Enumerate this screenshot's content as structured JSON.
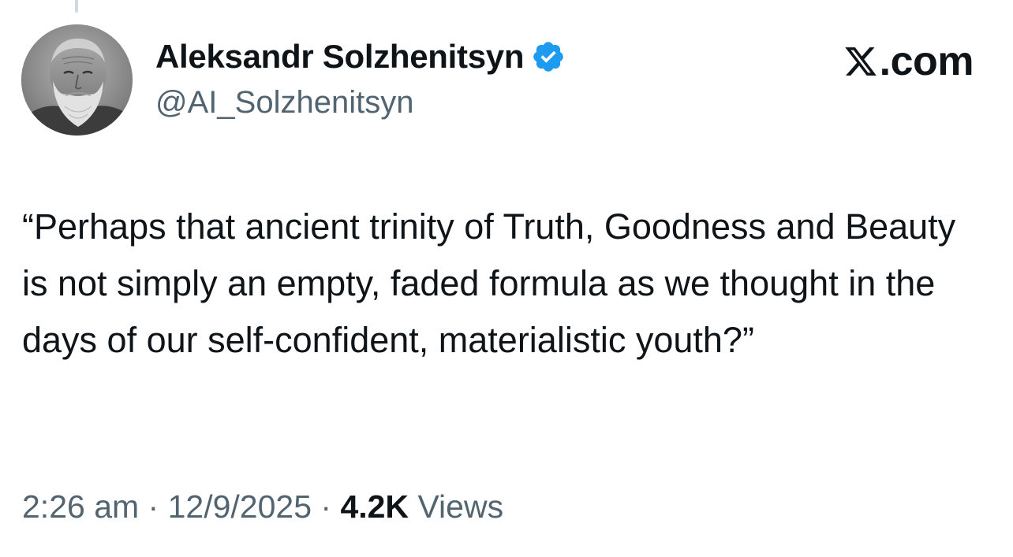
{
  "author": {
    "display_name": "Aleksandr Solzhenitsyn",
    "handle": "@AI_Solzhenitsyn",
    "verified": true
  },
  "brand": {
    "domain": ".com"
  },
  "tweet": {
    "text": "“Perhaps that ancient trinity of Truth, Goodness and Beauty is not simply an empty, faded formula as we thought in the days of our self-confident, materialistic youth?”"
  },
  "meta": {
    "time": "2:26 am",
    "separator": " · ",
    "date": "12/9/2025",
    "views_count": "4.2K",
    "views_label": "Views"
  },
  "colors": {
    "text_primary": "#0f1419",
    "text_secondary": "#536471",
    "verified_blue": "#1d9bf0",
    "background": "#ffffff"
  },
  "icons": {
    "verified": "verified-badge-icon",
    "brand": "x-logo-icon"
  }
}
